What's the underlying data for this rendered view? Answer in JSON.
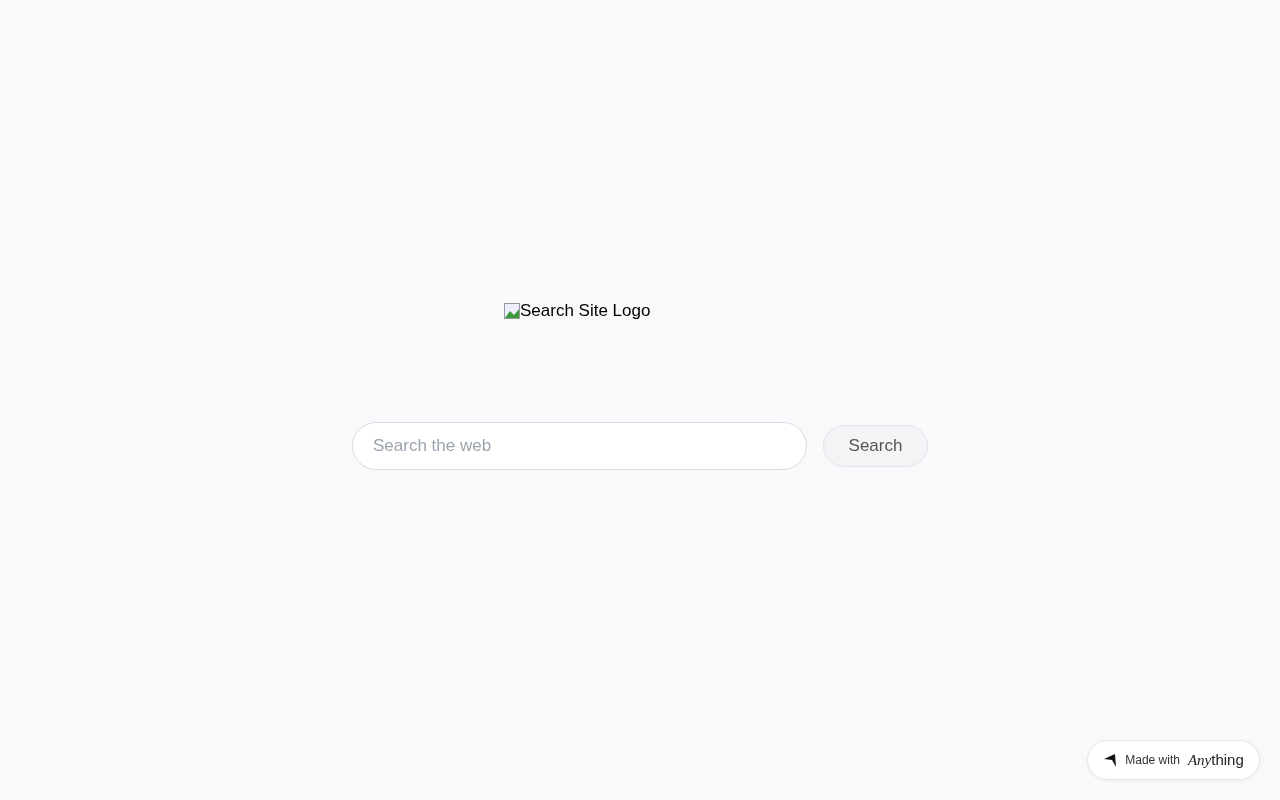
{
  "logo": {
    "alt": "Search Site Logo"
  },
  "search": {
    "placeholder": "Search the web",
    "button": "Search"
  },
  "badge": {
    "prefix": "Made with",
    "brand_italic": "Any",
    "brand_rest": "thing"
  }
}
